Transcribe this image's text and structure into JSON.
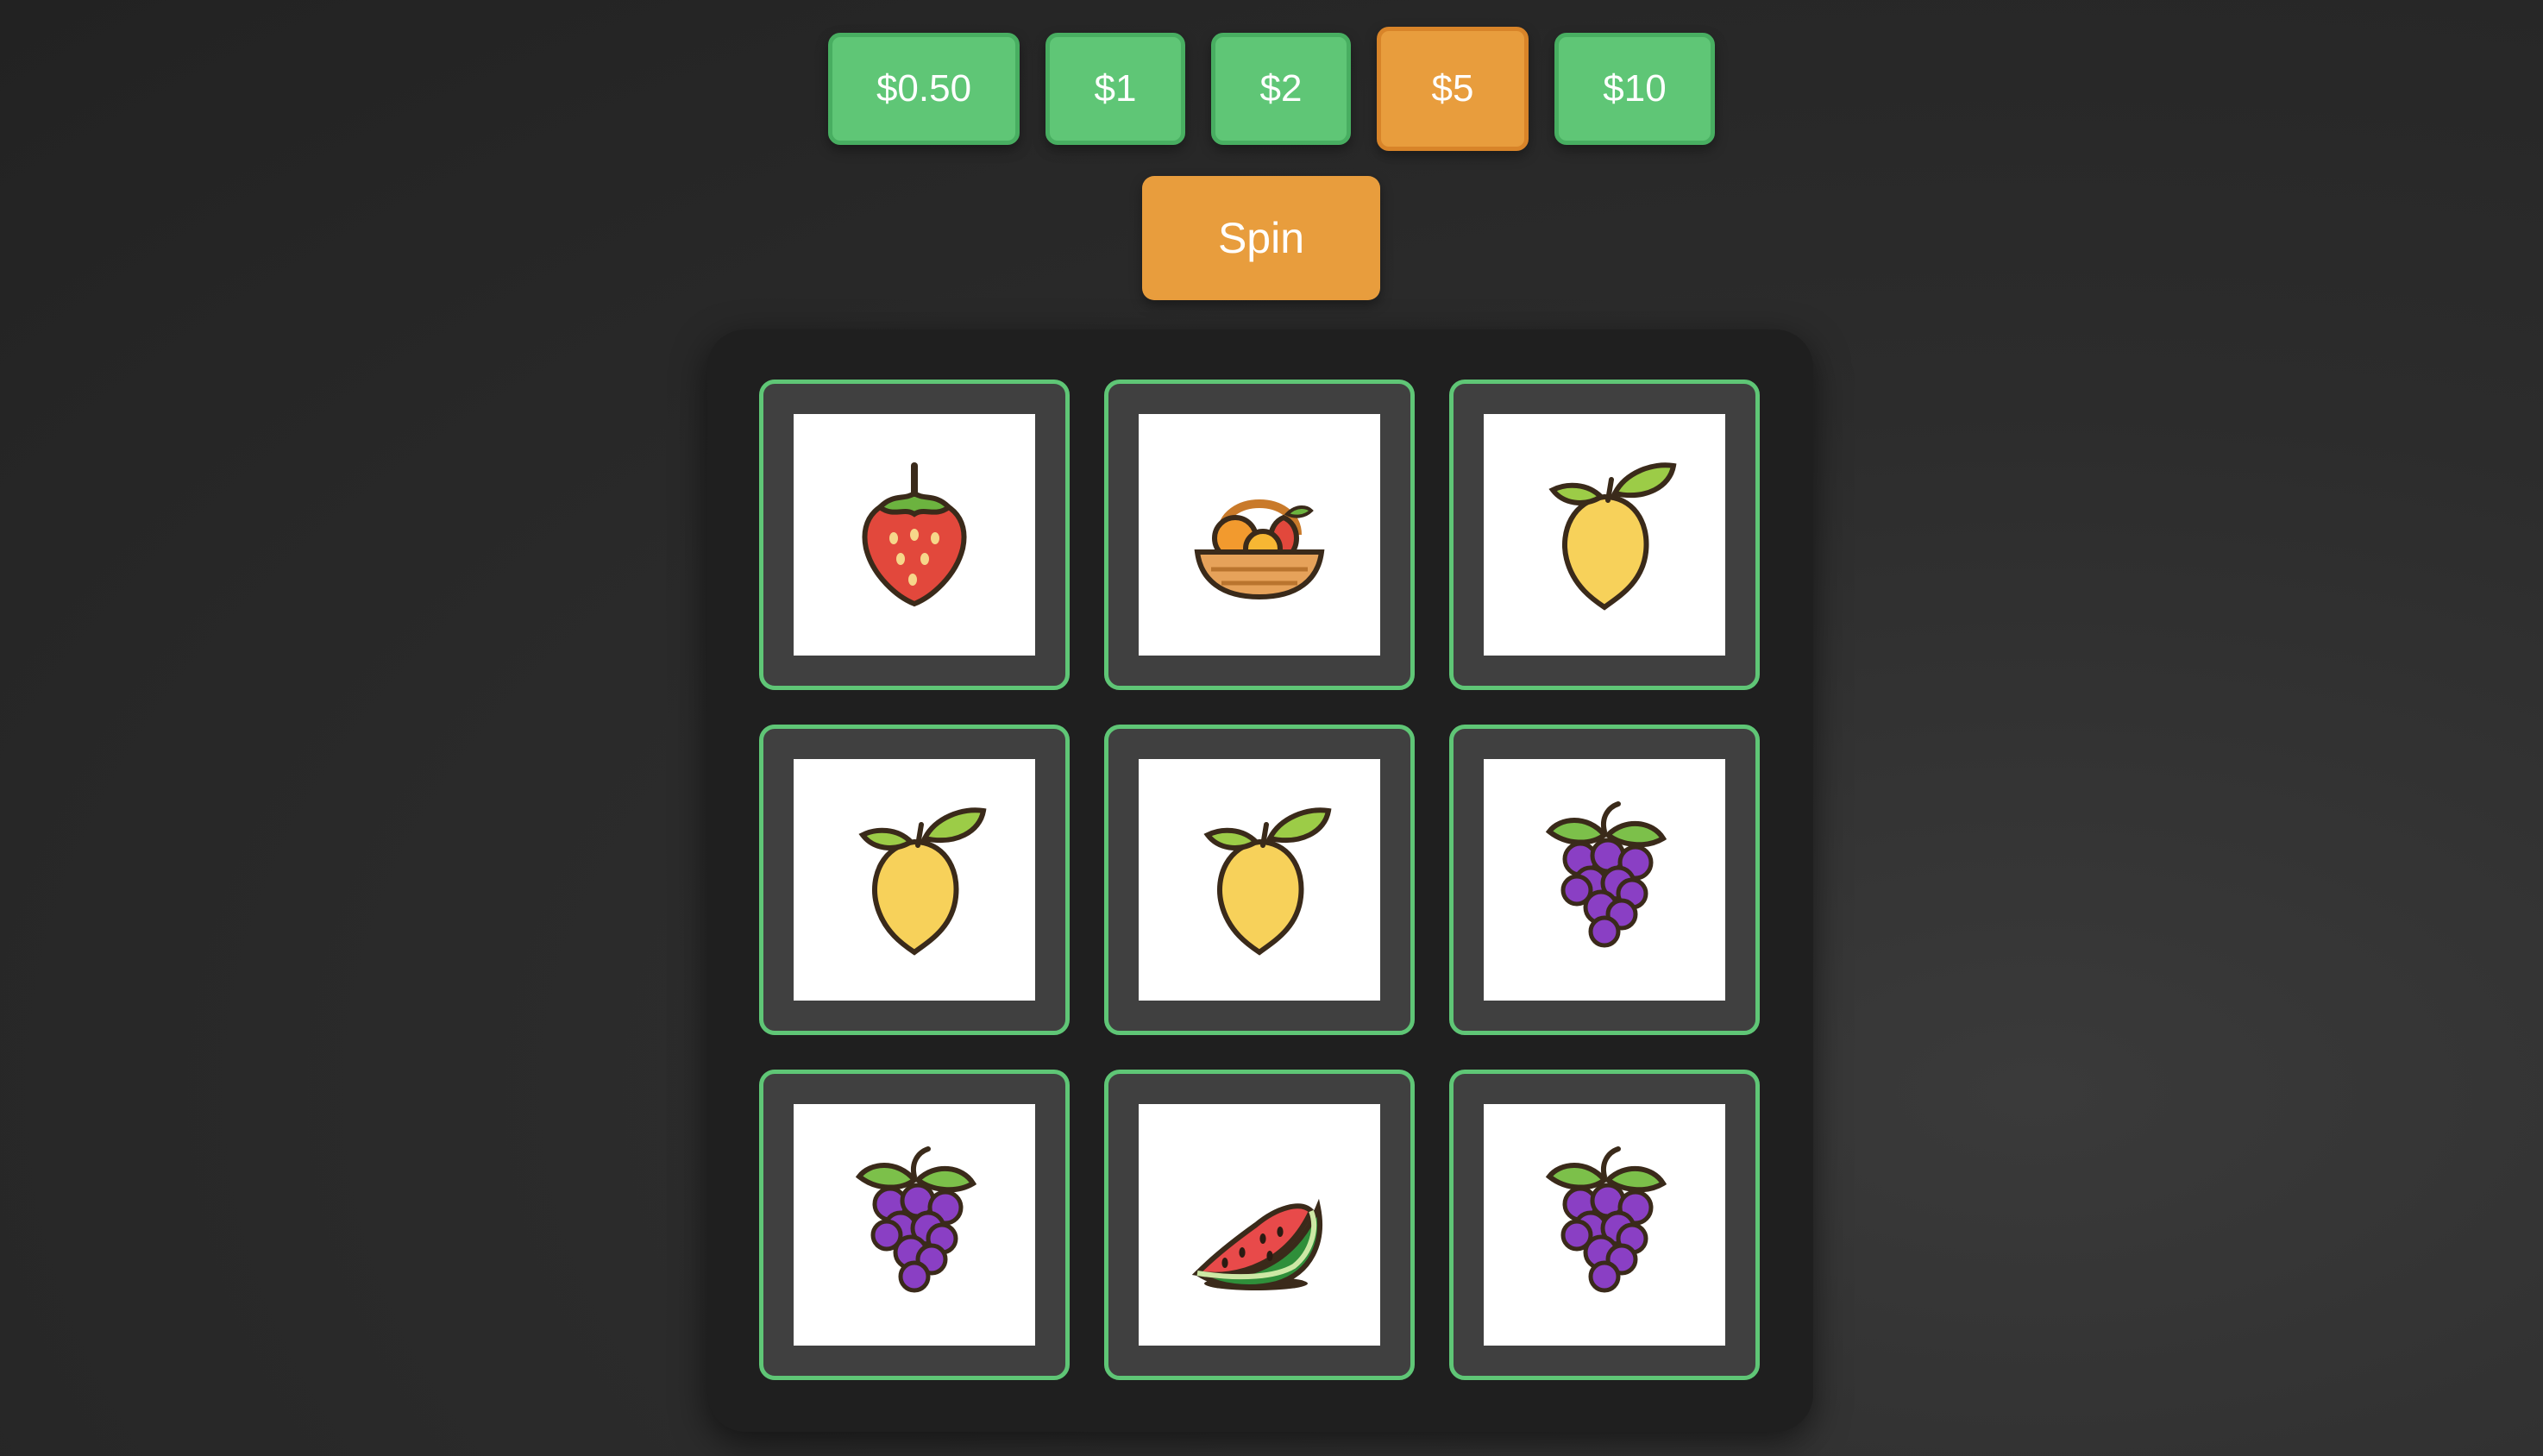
{
  "bets": [
    {
      "label": "$0.50",
      "selected": false
    },
    {
      "label": "$1",
      "selected": false
    },
    {
      "label": "$2",
      "selected": false
    },
    {
      "label": "$5",
      "selected": true
    },
    {
      "label": "$10",
      "selected": false
    }
  ],
  "spin_label": "Spin",
  "reels": [
    [
      "strawberry",
      "fruit-basket",
      "lemon"
    ],
    [
      "lemon",
      "lemon",
      "grapes"
    ],
    [
      "grapes",
      "watermelon",
      "grapes"
    ]
  ],
  "colors": {
    "bet_button": "#5fc676",
    "selected_button": "#e89d3d",
    "spin_button": "#e89d3d",
    "slot_border": "#5fc676",
    "slot_frame": "#404040",
    "machine_panel": "#1f1f1f"
  }
}
